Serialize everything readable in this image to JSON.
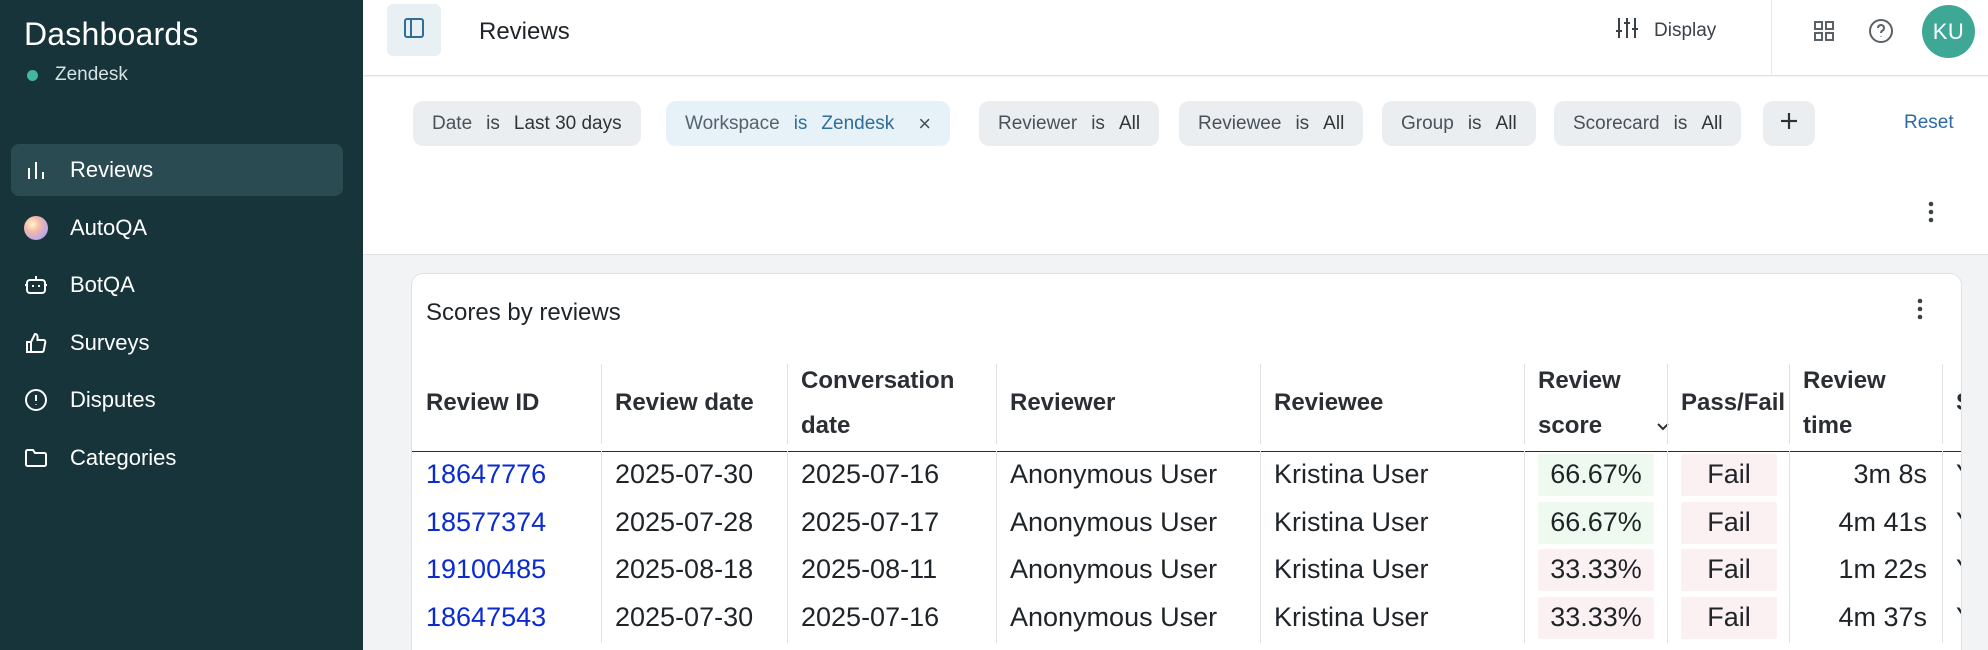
{
  "sidebar": {
    "title": "Dashboards",
    "workspace": "Zendesk",
    "items": [
      {
        "label": "Reviews",
        "icon": "bar-chart-icon",
        "active": true
      },
      {
        "label": "AutoQA",
        "icon": "autoqa-gradient-icon",
        "active": false
      },
      {
        "label": "BotQA",
        "icon": "bot-icon",
        "active": false
      },
      {
        "label": "Surveys",
        "icon": "thumbs-up-icon",
        "active": false
      },
      {
        "label": "Disputes",
        "icon": "alert-circle-icon",
        "active": false
      },
      {
        "label": "Categories",
        "icon": "folder-icon",
        "active": false
      }
    ]
  },
  "header": {
    "title": "Reviews",
    "display_label": "Display",
    "avatar_initials": "KU"
  },
  "filters": {
    "chips": [
      {
        "field": "Date",
        "op": "is",
        "value": "Last 30 days"
      },
      {
        "field": "Workspace",
        "op": "is",
        "value": "Zendesk",
        "removable": true
      },
      {
        "field": "Reviewer",
        "op": "is",
        "value": "All"
      },
      {
        "field": "Reviewee",
        "op": "is",
        "value": "All"
      },
      {
        "field": "Group",
        "op": "is",
        "value": "All"
      },
      {
        "field": "Scorecard",
        "op": "is",
        "value": "All"
      }
    ],
    "remove_glyph": "×",
    "reset_label": "Reset"
  },
  "card": {
    "title": "Scores by reviews",
    "columns": [
      {
        "line1": "Review ID",
        "line2": ""
      },
      {
        "line1": "Review date",
        "line2": ""
      },
      {
        "line1": "Conversation",
        "line2": "date"
      },
      {
        "line1": "Reviewer",
        "line2": ""
      },
      {
        "line1": "Reviewee",
        "line2": ""
      },
      {
        "line1": "Review",
        "line2": "score"
      },
      {
        "line1": "Pass/Fail",
        "line2": ""
      },
      {
        "line1": "Review",
        "line2": "time"
      },
      {
        "line1": "S",
        "line2": ""
      }
    ],
    "rows": [
      {
        "id": "18647776",
        "review_date": "2025-07-30",
        "conversation_date": "2025-07-16",
        "reviewer": "Anonymous User",
        "reviewee": "Kristina User",
        "score": "66.67%",
        "pass_fail": "Fail",
        "time": "3m 8s",
        "extra": "Y"
      },
      {
        "id": "18577374",
        "review_date": "2025-07-28",
        "conversation_date": "2025-07-17",
        "reviewer": "Anonymous User",
        "reviewee": "Kristina User",
        "score": "66.67%",
        "pass_fail": "Fail",
        "time": "4m 41s",
        "extra": "Y"
      },
      {
        "id": "19100485",
        "review_date": "2025-08-18",
        "conversation_date": "2025-08-11",
        "reviewer": "Anonymous User",
        "reviewee": "Kristina User",
        "score": "33.33%",
        "pass_fail": "Fail",
        "time": "1m 22s",
        "extra": "Y"
      },
      {
        "id": "18647543",
        "review_date": "2025-07-30",
        "conversation_date": "2025-07-16",
        "reviewer": "Anonymous User",
        "reviewee": "Kristina User",
        "score": "33.33%",
        "pass_fail": "Fail",
        "time": "4m 37s",
        "extra": "Y"
      }
    ]
  },
  "colors": {
    "sidebar_bg": "#17343a",
    "active_nav_bg": "#2a4b51",
    "link": "#0a2bd1",
    "score_high_bg": "#eefaf0",
    "score_low_bg": "#fbf1f2",
    "fail_bg": "#fbf1f2",
    "avatar_bg": "#3fa796"
  }
}
